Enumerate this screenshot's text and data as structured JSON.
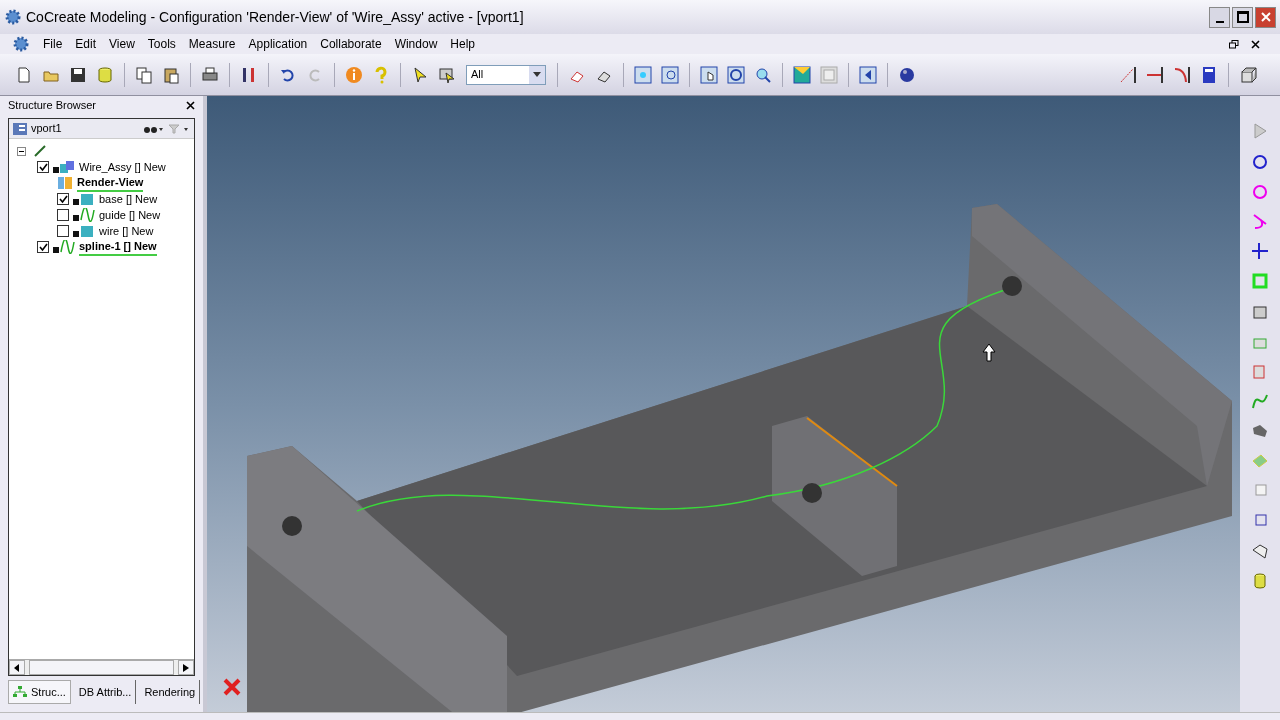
{
  "window": {
    "title": "CoCreate Modeling - Configuration 'Render-View' of 'Wire_Assy' active - [vport1]"
  },
  "menu": [
    "File",
    "Edit",
    "View",
    "Tools",
    "Measure",
    "Application",
    "Collaborate",
    "Window",
    "Help"
  ],
  "toolbar": {
    "filter": {
      "value": "All"
    }
  },
  "structure_browser": {
    "title": "Structure Browser",
    "viewport": "vport1",
    "tree": [
      {
        "kind": "root",
        "children": [
          {
            "kind": "assembly",
            "label": "Wire_Assy [] New",
            "checked": true,
            "active": false,
            "children": [
              {
                "kind": "config",
                "label": "Render-View",
                "active": true
              },
              {
                "kind": "part",
                "label": "base [] New",
                "checked": true,
                "active": false
              },
              {
                "kind": "curve",
                "label": "guide [] New",
                "checked": false,
                "active": false
              },
              {
                "kind": "part",
                "label": "wire [] New",
                "checked": false,
                "active": false
              }
            ]
          },
          {
            "kind": "curve",
            "label": "spline-1 [] New",
            "checked": true,
            "active": true
          }
        ]
      }
    ],
    "tabs": [
      {
        "label": "Struc...",
        "selected": true
      },
      {
        "label": "DB Attrib...",
        "selected": false
      },
      {
        "label": "Rendering",
        "selected": false
      }
    ]
  }
}
